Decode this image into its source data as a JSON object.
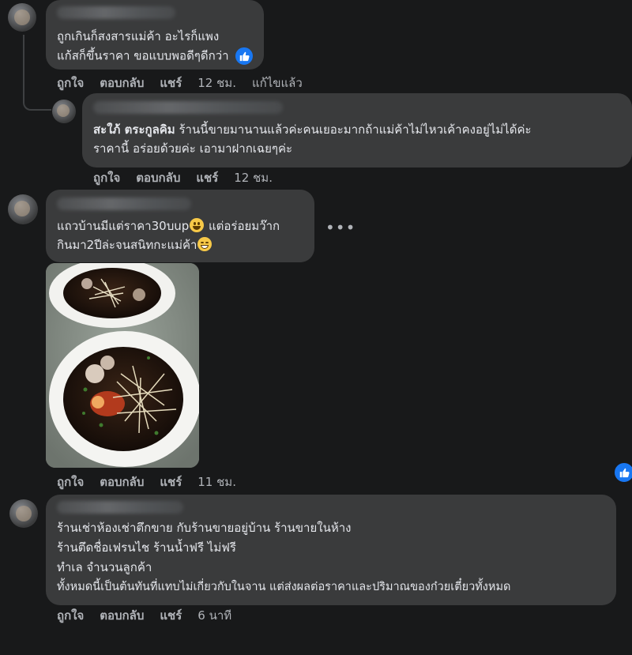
{
  "comments": [
    {
      "lines": [
        "ถูกเกินก็สงสารแม่ค้า อะไรก็แพง",
        "แก้สก็ขึ้นราคา ขอแบบพอดีๆดีกว่า"
      ],
      "reaction_icon": "like-icon",
      "actions": {
        "like": "ถูกใจ",
        "reply": "ตอบกลับ",
        "share": "แชร์",
        "time": "12 ชม.",
        "edited": "แก้ไขแล้ว"
      }
    },
    {
      "mention": "สะใภ้ ตระกูลคิม",
      "line1_rest": " ร้านนี้ขายมานานแล้วค่ะคนเยอะมากถ้าแม่ค้าไม่ไหวเค้าคงอยู่ไม่ได้ค่ะ",
      "line2": "ราคานี้ อร่อยด้วยค่ะ เอามาฝากเฉยๆค่ะ",
      "actions": {
        "like": "ถูกใจ",
        "reply": "ตอบกลับ",
        "share": "แชร์",
        "time": "12 ชม."
      }
    },
    {
      "line1_a": "แถวบ้านมีแต่ราคา30บup",
      "line1_b": " แต่อร่อยมว๊าก",
      "line2_a": "กินมา2ปีล่ะจนสนิทกะแม่ค้า",
      "more": "•••",
      "actions": {
        "like": "ถูกใจ",
        "reply": "ตอบกลับ",
        "share": "แชร์",
        "time": "11 ชม."
      }
    },
    {
      "lines": [
        "ร้านเช่าห้องเช่าตึกขาย กับร้านขายอยู่บ้าน ร้านขายในห้าง",
        "ร้านตึดชื่อเฟรนไช ร้านน้ำฟรี ไม่ฟรี",
        "ทำเล จำนวนลูกค้า",
        "ทั้งหมดนี้เป็นต้นทันที่แทบไม่เกี่ยวกับในจาน แต่ส่งผลต่อราคาและปริมาณของก๋วยเตี๋ยวทั้งหมด"
      ],
      "actions": {
        "like": "ถูกใจ",
        "reply": "ตอบกลับ",
        "share": "แชร์",
        "time": "6 นาที"
      }
    }
  ],
  "colors": {
    "background": "#18191a",
    "bubble": "#3a3b3c",
    "text": "#e4e6eb",
    "meta": "#b0b3b8",
    "like_blue": "#1877f2"
  }
}
